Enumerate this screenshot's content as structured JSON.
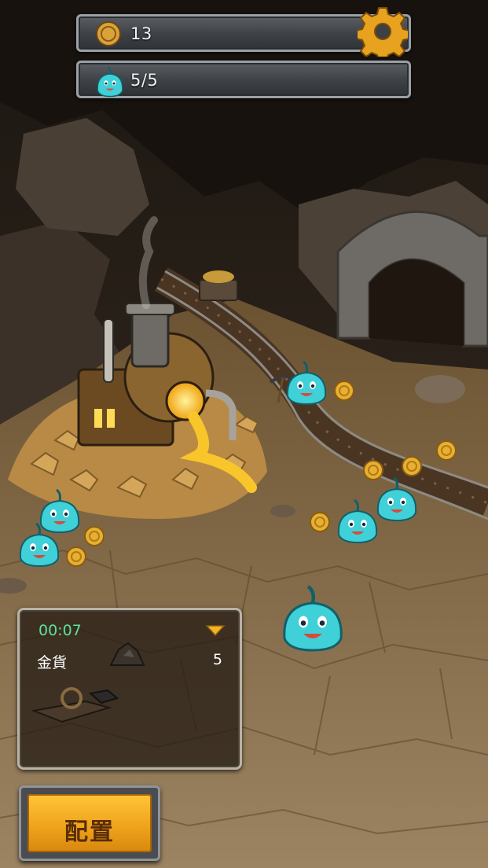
{
  "hud": {
    "coins": "13",
    "slimes": "5/5"
  },
  "icons": {
    "coin": "coin-icon",
    "slime": "slime-icon",
    "settings": "gear-icon",
    "gem": "gem-icon",
    "ore": "ore-icon",
    "tools": "mining-tools-icon"
  },
  "panel": {
    "timer": "00:07",
    "reward_label": "金貨",
    "reward_count": "5"
  },
  "deploy_button": {
    "label": "配置"
  },
  "colors": {
    "slime": "#3fd0d8",
    "coin": "#e0a82a",
    "timer": "#5fe09a",
    "button": "#f0a41c"
  }
}
